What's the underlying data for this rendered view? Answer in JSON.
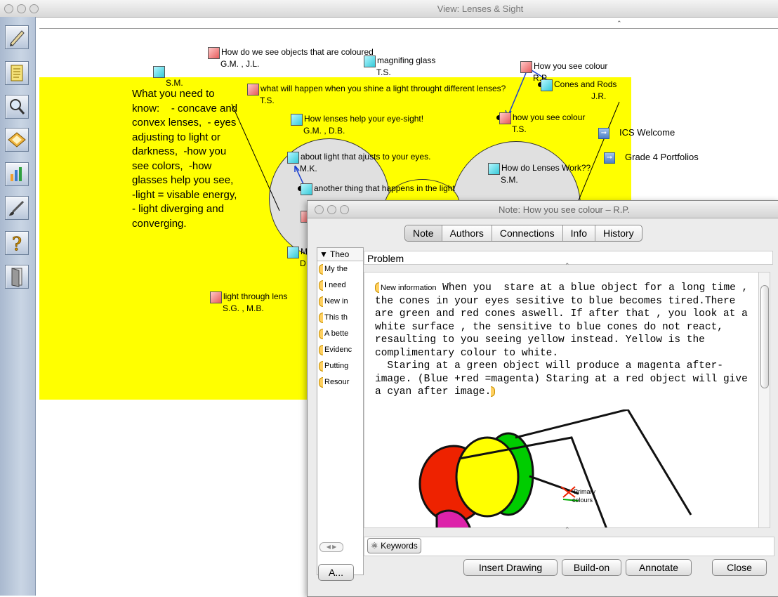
{
  "main_window": {
    "title": "View: Lenses & Sight"
  },
  "toolbar": {
    "tools": [
      "pencil-icon",
      "script-icon",
      "magnifier-icon",
      "note-stack-icon",
      "chart-icon",
      "brush-icon",
      "help-icon",
      "door-icon"
    ]
  },
  "canvas": {
    "notes": [
      {
        "title": "How do we see objects that are coloured",
        "authors": "G.M. , J.L.",
        "color": "red"
      },
      {
        "title": "magnifing glass",
        "authors": "T.S.",
        "color": "cyan"
      },
      {
        "title": "",
        "authors": "S.M.",
        "color": "cyan"
      },
      {
        "title": "How you see colour",
        "authors": "R.P.",
        "color": "red"
      },
      {
        "title": "Cones and Rods",
        "authors": "J.R.",
        "color": "cyan"
      },
      {
        "title": "what will happen when you shine a light throught different lenses?",
        "authors": "T.S.",
        "color": "red"
      },
      {
        "title": "How lenses help your eye-sight!",
        "authors": "G.M. , D.B.",
        "color": "cyan"
      },
      {
        "title": "how you see colour",
        "authors": "T.S.",
        "color": "red"
      },
      {
        "title": "about light  that ajusts to your eyes.",
        "authors": "M.K.",
        "color": "cyan"
      },
      {
        "title": "How do Lenses Work??",
        "authors": "S.M.",
        "color": "cyan"
      },
      {
        "title": "another thing that happens in the light",
        "authors": "T.S.",
        "color": "cyan"
      },
      {
        "title": "light through lens",
        "authors": "S.G. , M.B.",
        "color": "red"
      },
      {
        "title": "M",
        "authors": "D",
        "color": "cyan"
      }
    ],
    "need_text": "What you need to know:    - concave and convex lenses,  - eyes adjusting to light or darkness,  -how you see colors,  -how glasses help you see,  -light = visable energy,  - light diverging and converging.",
    "links": [
      {
        "label": "ICS Welcome"
      },
      {
        "label": "Grade 4 Portfolios"
      }
    ]
  },
  "note_window": {
    "title": "Note: How you see colour – R.P.",
    "tabs": [
      "Note",
      "Authors",
      "Connections",
      "Info",
      "History"
    ],
    "left_pane": {
      "header": "Theo",
      "items": [
        "My the",
        "I need",
        "New in",
        "This th",
        "A bette",
        "Evidenc",
        "Putting",
        "Resour"
      ]
    },
    "problem_label": "Problem",
    "scaffold_label": "New information",
    "body_text": " When you  stare at a blue object for a long time , the cones in your eyes sesitive to blue becomes tired.There are green and red cones aswell. If after that , you look at a white surface , the sensitive to blue cones do not react, resaulting to you seeing yellow instead. Yellow is the complimentary colour to white.\n  Staring at a green object will produce a magenta after-image. (Blue +red =magenta) Staring at a red object will give a cyan after image.",
    "drawing_labels": [
      "Primary",
      "colours"
    ],
    "keywords_label": "Keywords",
    "author_button": "A...",
    "buttons": {
      "insert_drawing": "Insert Drawing",
      "build_on": "Build-on",
      "annotate": "Annotate",
      "close": "Close"
    }
  }
}
